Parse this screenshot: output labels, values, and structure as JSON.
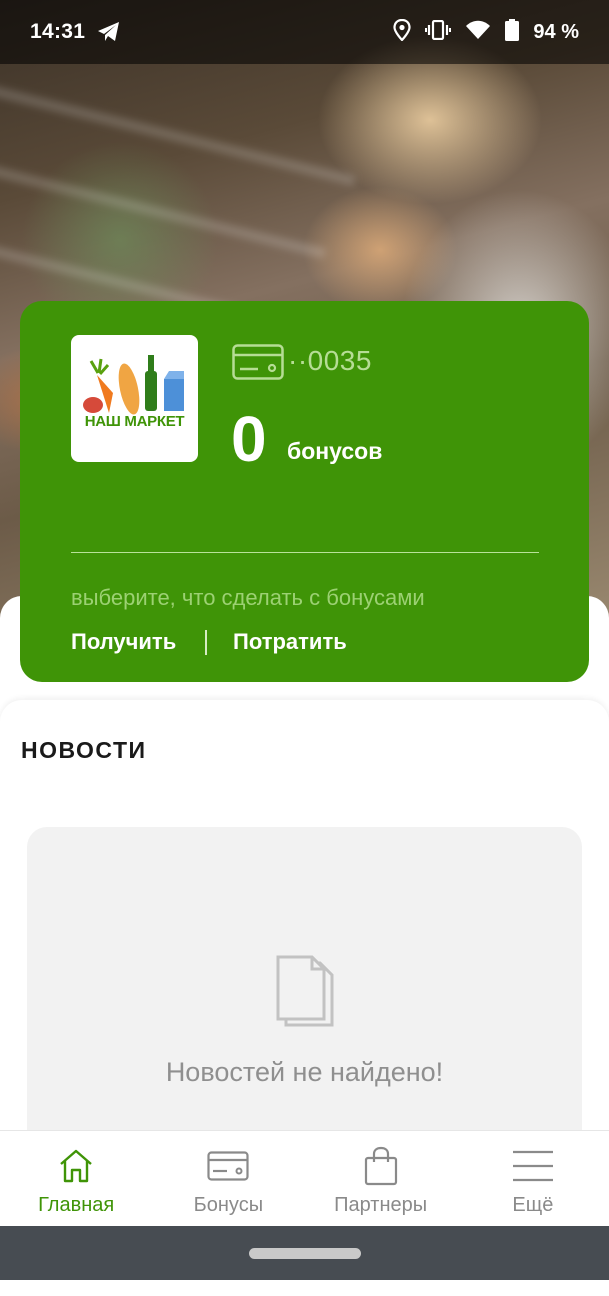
{
  "status_bar": {
    "time": "14:31",
    "battery_percent": "94 %",
    "icons": [
      "telegram-icon",
      "location-icon",
      "vibrate-icon",
      "wifi-icon",
      "battery-icon"
    ]
  },
  "card": {
    "brand_logo_text": "НАШ МАРКЕТ",
    "card_number": "··0035",
    "bonus_value": "0",
    "bonus_label": "бонусов",
    "hint": "выберите, что сделать с бонусами",
    "actions": {
      "get": "Получить",
      "spend": "Потратить"
    }
  },
  "news": {
    "title": "НОВОСТИ",
    "empty_text": "Новостей не найдено!"
  },
  "bottom_nav": {
    "items": [
      {
        "label": "Главная",
        "icon": "home-icon",
        "active": true
      },
      {
        "label": "Бонусы",
        "icon": "card-icon",
        "active": false
      },
      {
        "label": "Партнеры",
        "icon": "bag-icon",
        "active": false
      },
      {
        "label": "Ещё",
        "icon": "menu-icon",
        "active": false
      }
    ]
  },
  "colors": {
    "brand_green": "#3f9407",
    "card_number": "#b6dd95",
    "nav_inactive": "#8a8a8a",
    "system_nav": "#474c52"
  }
}
